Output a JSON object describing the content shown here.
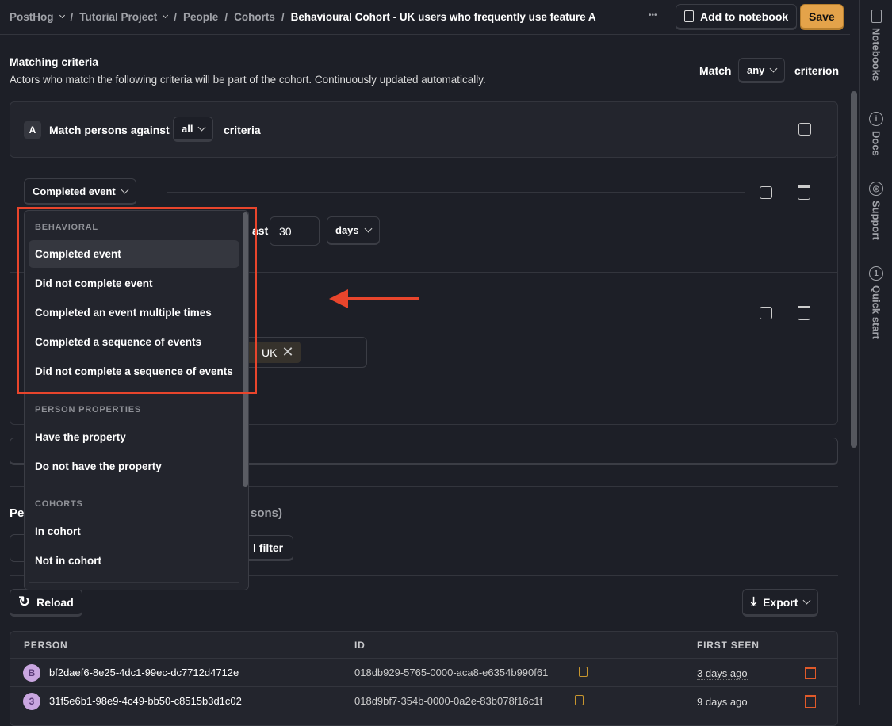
{
  "breadcrumb": {
    "items": [
      "PostHog",
      "Tutorial Project",
      "People",
      "Cohorts"
    ],
    "current": "Behavioural Cohort - UK users who frequently use feature A"
  },
  "header": {
    "more_label": "•••",
    "add_to_notebook": "Add to notebook",
    "save": "Save"
  },
  "criteria": {
    "title": "Matching criteria",
    "description": "Actors who match the following criteria will be part of the cohort. Continuously updated automatically.",
    "match_label": "Match",
    "match_value": "any",
    "criterion_label": "criterion"
  },
  "group": {
    "letter": "A",
    "prefix": "Match persons against",
    "value": "all",
    "suffix": "criteria"
  },
  "row1": {
    "type": "Completed event",
    "partial_label": "ast",
    "days_value": "30",
    "unit": "days"
  },
  "row2": {
    "tag": "UK"
  },
  "dropdown": {
    "sections": [
      {
        "title": "BEHAVIORAL",
        "items": [
          "Completed event",
          "Did not complete event",
          "Completed an event multiple times",
          "Completed a sequence of events",
          "Did not complete a sequence of events"
        ]
      },
      {
        "title": "PERSON PROPERTIES",
        "items": [
          "Have the property",
          "Do not have the property"
        ]
      },
      {
        "title": "COHORTS",
        "items": [
          "In cohort",
          "Not in cohort"
        ]
      }
    ],
    "selected": "Completed event"
  },
  "persons": {
    "title_partial": "Pe",
    "count_partial": "sons)",
    "filter_partial": "l filter"
  },
  "toolbar": {
    "reload": "Reload",
    "export": "Export"
  },
  "table": {
    "columns": [
      "PERSON",
      "ID",
      "FIRST SEEN"
    ],
    "rows": [
      {
        "avatar": "B",
        "person": "bf2daef6-8e25-4dc1-99ec-dc7712d4712e",
        "id": "018db929-5765-0000-aca8-e6354b990f61",
        "first_seen": "3 days ago"
      },
      {
        "avatar": "3",
        "person": "31f5e6b1-98e9-4c49-bb50-c8515b3d1c02",
        "id": "018d9bf7-354b-0000-0a2e-83b078f16c1f",
        "first_seen": "9 days ago"
      }
    ]
  },
  "sidebar": {
    "items": [
      "Notebooks",
      "Docs",
      "Support",
      "Quick start"
    ],
    "quick_start_badge": "1"
  },
  "colors": {
    "accent": "#e4a34a",
    "annotation": "#e8452c",
    "danger": "#e05a2a",
    "background": "#1d1f27"
  }
}
